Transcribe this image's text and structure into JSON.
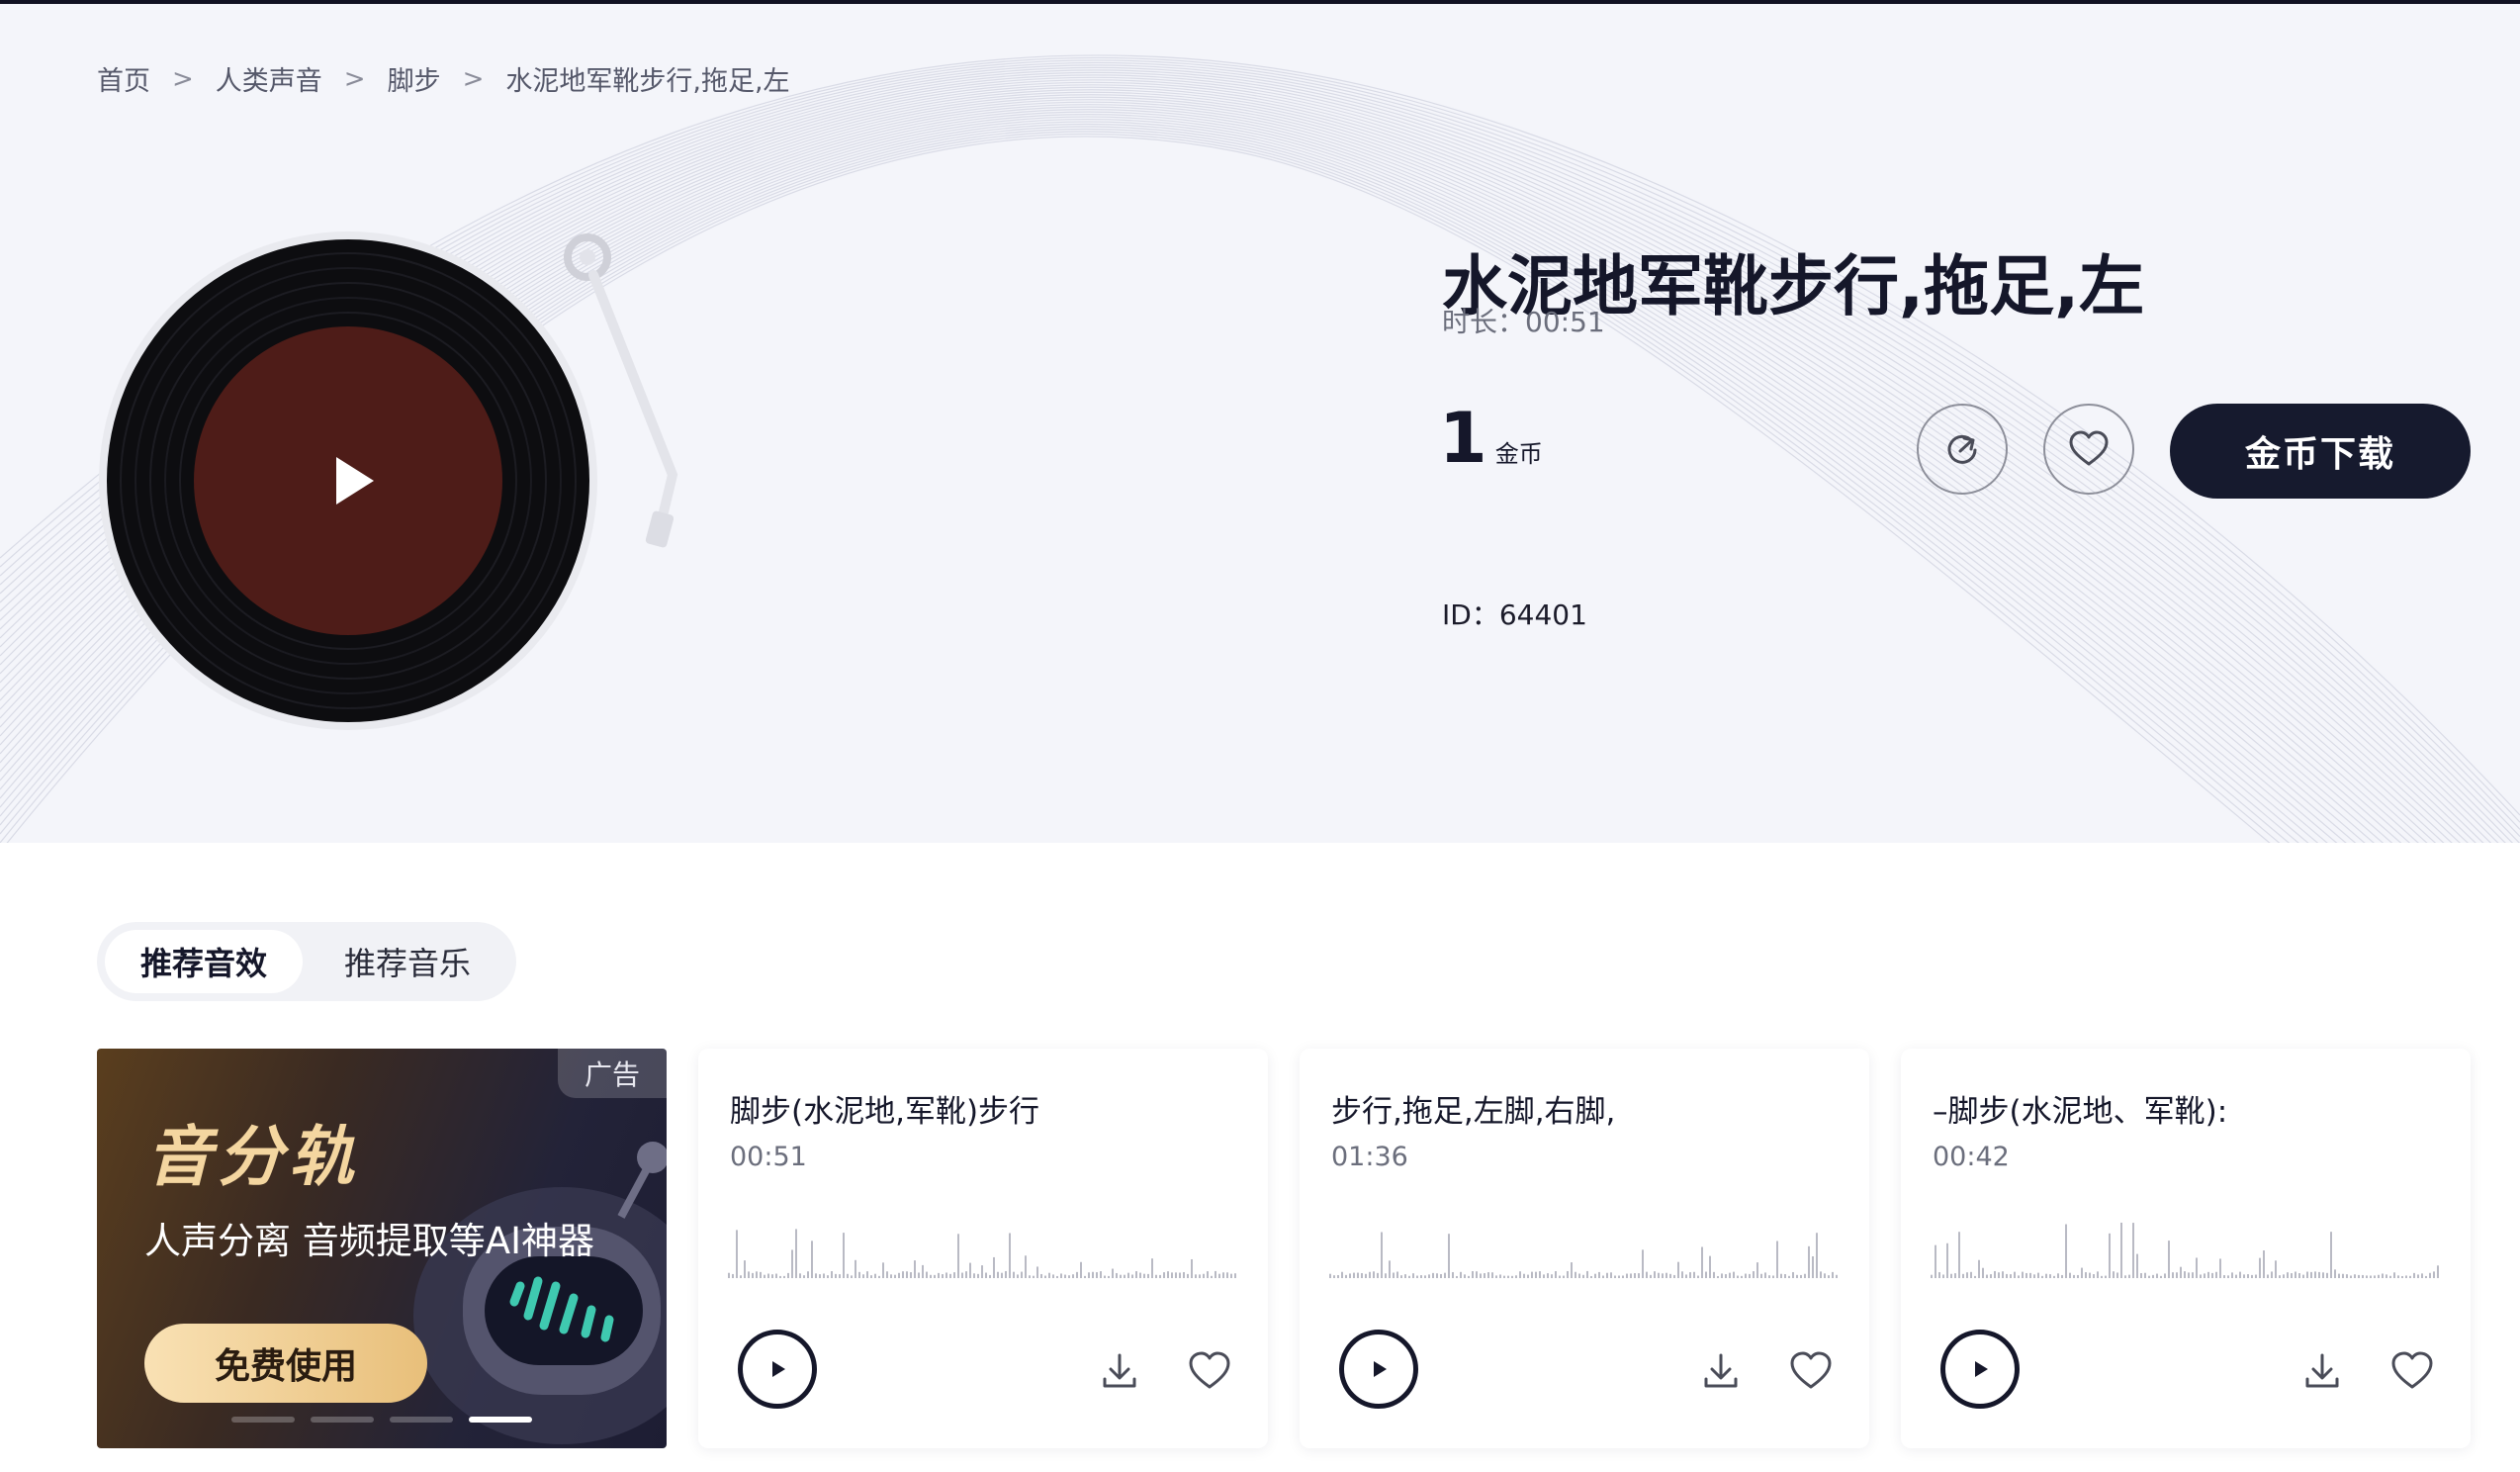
{
  "breadcrumb": {
    "items": [
      "首页",
      "人类声音",
      "脚步",
      "水泥地军靴步行,拖足,左"
    ],
    "separator": ">"
  },
  "sound": {
    "title": "水泥地军靴步行,拖足,左",
    "duration_text": "时长：00:51",
    "price_value": "1",
    "price_unit": "金币",
    "download_label": "金币下载",
    "id_text": "ID：64401"
  },
  "tabs": {
    "active": "推荐音效",
    "inactive": "推荐音乐"
  },
  "ad": {
    "badge": "广告",
    "brand": "音分轨",
    "slogan": "人声分离 音频提取等AI神器",
    "cta": "免费使用",
    "carousel_active_index": 3,
    "carousel_count": 4
  },
  "cards": [
    {
      "title": "脚步(水泥地,军靴)步行",
      "time": "00:51"
    },
    {
      "title": "步行,拖足,左脚,右脚,",
      "time": "01:36"
    },
    {
      "title": "–脚步(水泥地、军靴):",
      "time": "00:42"
    }
  ],
  "icons": {
    "vinyl_play": "play-icon",
    "share": "share-icon",
    "favorite": "heart-icon",
    "download": "download-icon"
  },
  "colors": {
    "primary_dark": "#161a2e",
    "hero_bg": "#f4f5fa",
    "vinyl_label": "#4e1c18",
    "cta_gold": "#f9e1b4"
  }
}
